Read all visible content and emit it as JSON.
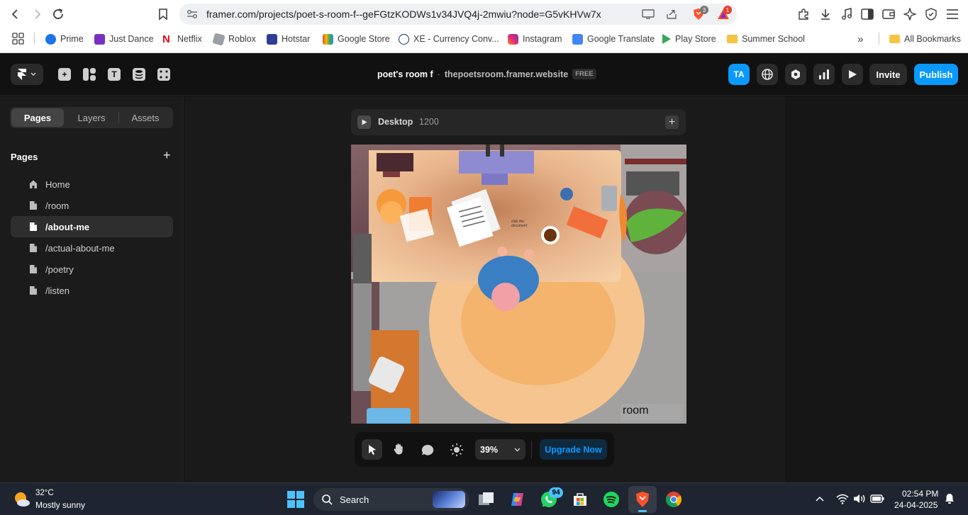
{
  "browser": {
    "url": "framer.com/projects/poet-s-room-f--geFGtzKODWs1v34JVQ4j-2mwiu?node=G5vKHVw7x",
    "brave_badge": "3",
    "rewards_badge": "1",
    "bookmarks": [
      {
        "label": "Prime",
        "color": "#1a73e8"
      },
      {
        "label": "Just Dance",
        "color": "#7b2fbe"
      },
      {
        "label": "Netflix",
        "color": "#e50914"
      },
      {
        "label": "Roblox",
        "color": "#9aa0a6"
      },
      {
        "label": "Hotstar",
        "color": "#2c3e95"
      },
      {
        "label": "Google Store",
        "color": "#f9ab00"
      },
      {
        "label": "XE - Currency Conv...",
        "color": "#0b2f6b"
      },
      {
        "label": "Instagram",
        "color": "#d6249f"
      },
      {
        "label": "Google Translate",
        "color": "#4285f4"
      },
      {
        "label": "Play Store",
        "color": "#34a853"
      },
      {
        "label": "Summer School",
        "color": "#f4c542"
      }
    ],
    "overflow": "»",
    "all_bookmarks": "All Bookmarks"
  },
  "framer": {
    "project_title": "poet's room f",
    "separator": "·",
    "site_domain": "thepoetsroom.framer.website",
    "plan_badge": "FREE",
    "avatar_initials": "TA",
    "invite_label": "Invite",
    "publish_label": "Publish",
    "accent": "#0a99ff",
    "tabs": [
      "Pages",
      "Layers",
      "Assets"
    ],
    "pages_heading": "Pages",
    "add_icon": "+",
    "pages": [
      {
        "label": "Home",
        "icon": "home-icon"
      },
      {
        "label": "/room",
        "icon": "page-icon"
      },
      {
        "label": "/about-me",
        "icon": "page-icon",
        "selected": true
      },
      {
        "label": "/actual-about-me",
        "icon": "page-icon"
      },
      {
        "label": "/poetry",
        "icon": "page-icon"
      },
      {
        "label": "/listen",
        "icon": "page-icon"
      }
    ],
    "breakpoint": {
      "name": "Desktop",
      "width": "1200"
    },
    "canvas_caption": "room",
    "canvas_small_text": "click the document",
    "zoom": "39%",
    "upgrade_label": "Upgrade Now"
  },
  "taskbar": {
    "temperature": "32°C",
    "weather": "Mostly sunny",
    "search_placeholder": "Search",
    "whatsapp_badge": "94",
    "time": "02:54 PM",
    "date": "24-04-2025"
  }
}
